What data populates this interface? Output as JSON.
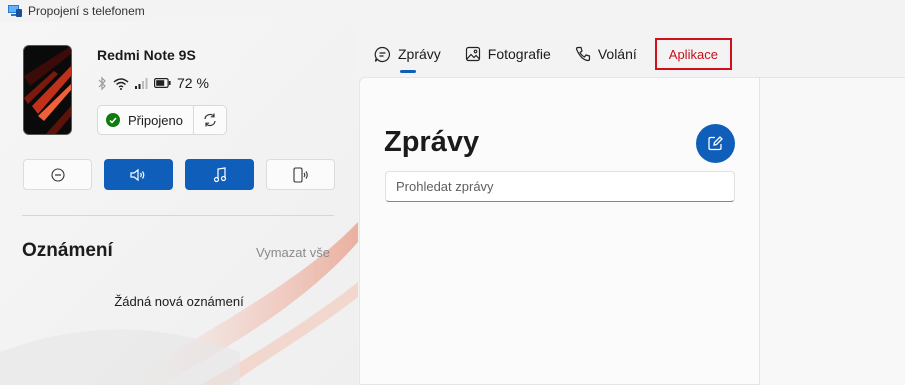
{
  "window": {
    "title": "Propojení s telefonem"
  },
  "device": {
    "name": "Redmi Note 9S",
    "battery": "72 %",
    "connection_label": "Připojeno"
  },
  "notifications": {
    "title": "Oznámení",
    "clear_all": "Vymazat vše",
    "empty_text": "Žádná nová oznámení"
  },
  "tabs": [
    {
      "label": "Zprávy",
      "icon": "chat-icon",
      "active": true
    },
    {
      "label": "Fotografie",
      "icon": "photo-icon"
    },
    {
      "label": "Volání",
      "icon": "phone-icon"
    },
    {
      "label": "Aplikace",
      "icon": "",
      "highlighted": true
    }
  ],
  "messages": {
    "title": "Zprávy",
    "search_placeholder": "Prohledat zprávy"
  },
  "colors": {
    "accent": "#0f5fba",
    "connected": "#0f7b0f",
    "highlight_border": "#d0101c"
  }
}
